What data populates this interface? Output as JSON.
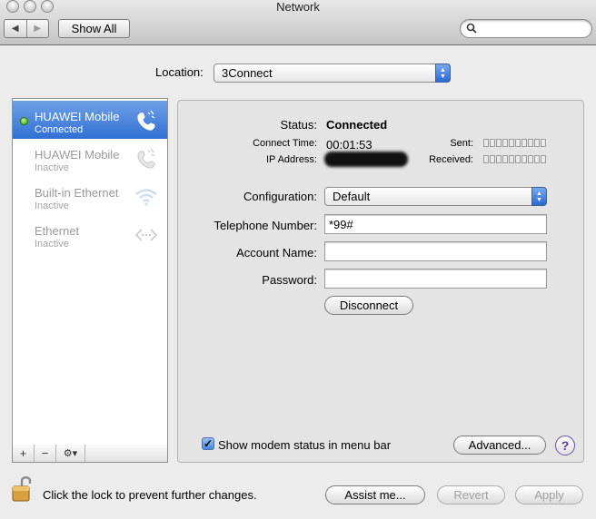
{
  "window": {
    "title": "Network"
  },
  "toolbar": {
    "show_all_label": "Show All",
    "search_placeholder": ""
  },
  "location": {
    "label": "Location:",
    "value": "3Connect"
  },
  "services": [
    {
      "name": "HUAWEI Mobile",
      "status": "Connected",
      "selected": true,
      "icon": "phone-icon"
    },
    {
      "name": "HUAWEI Mobile",
      "status": "Inactive",
      "selected": false,
      "icon": "phone-icon"
    },
    {
      "name": "Built-in Ethernet",
      "status": "Inactive",
      "selected": false,
      "icon": "wifi-icon"
    },
    {
      "name": "Ethernet",
      "status": "Inactive",
      "selected": false,
      "icon": "ethernet-icon"
    }
  ],
  "service_toolbar": {
    "add": "+",
    "remove": "−",
    "gear": "⚙▾"
  },
  "details": {
    "status_label": "Status:",
    "status_value": "Connected",
    "connect_time_label": "Connect Time:",
    "connect_time_value": "00:01:53",
    "ip_label": "IP Address:",
    "sent_label": "Sent:",
    "received_label": "Received:",
    "configuration_label": "Configuration:",
    "configuration_value": "Default",
    "telephone_label": "Telephone Number:",
    "telephone_value": "*99#",
    "account_label": "Account Name:",
    "account_value": "",
    "password_label": "Password:",
    "password_value": "",
    "disconnect_label": "Disconnect",
    "show_modem_status_label": "Show modem status in menu bar",
    "show_modem_status_checked": true,
    "advanced_label": "Advanced...",
    "help_label": "?"
  },
  "footer": {
    "lock_text": "Click the lock to prevent further changes.",
    "assist_label": "Assist me...",
    "revert_label": "Revert",
    "apply_label": "Apply"
  },
  "colors": {
    "selection": "#3b76d6",
    "status_green": "#36a800",
    "help_purple": "#5a3a9a"
  }
}
